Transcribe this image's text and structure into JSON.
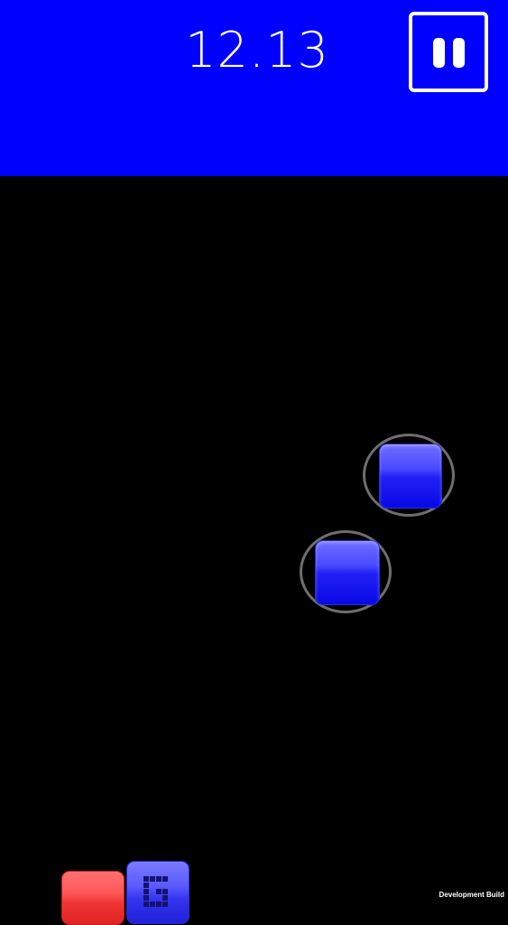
{
  "hud": {
    "timer": "12.13",
    "pause_icon": "pause-icon",
    "background_color": "#0000ff"
  },
  "field": {
    "background_color": "#000000",
    "target_ring_color": "#6e6e6e",
    "blue_tile_color": "#1414f0",
    "red_tile_color": "#f03c3c"
  },
  "footer": {
    "build_label": "Development Build"
  }
}
